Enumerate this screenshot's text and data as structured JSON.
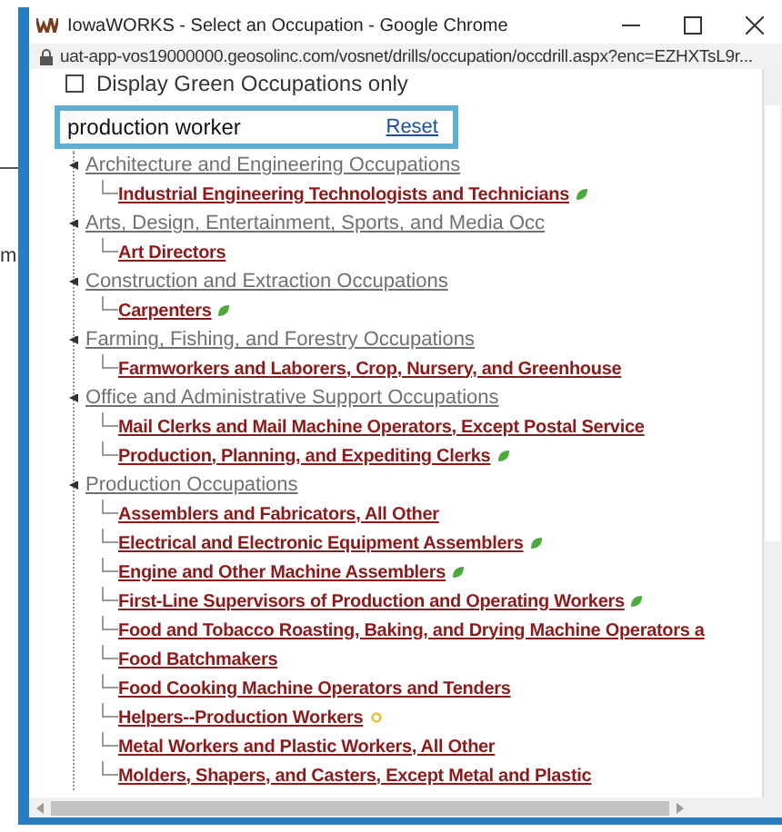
{
  "background_page": {
    "text": "m"
  },
  "window": {
    "title": "IowaWORKS - Select an Occupation - Google Chrome",
    "url": "uat-app-vos19000000.geosolinc.com/vosnet/drills/occupation/occdrill.aspx?enc=EZHXTsL9r..."
  },
  "green_only": {
    "label": "Display Green Occupations only",
    "checked": false
  },
  "search": {
    "value": "production worker",
    "reset": "Reset"
  },
  "tree": [
    {
      "label": "Architecture and Engineering Occupations",
      "children": [
        {
          "label": "Industrial Engineering Technologists and Technicians",
          "green": true,
          "bright_outlook": false
        }
      ]
    },
    {
      "label": "Arts, Design, Entertainment, Sports, and Media Occ",
      "children": [
        {
          "label": "Art Directors",
          "green": false,
          "bright_outlook": false
        }
      ]
    },
    {
      "label": "Construction and Extraction Occupations",
      "children": [
        {
          "label": "Carpenters",
          "green": true,
          "bright_outlook": false
        }
      ]
    },
    {
      "label": "Farming, Fishing, and Forestry Occupations",
      "children": [
        {
          "label": "Farmworkers and Laborers, Crop, Nursery, and Greenhouse",
          "green": false,
          "bright_outlook": false
        }
      ]
    },
    {
      "label": "Office and Administrative Support Occupations",
      "children": [
        {
          "label": "Mail Clerks and Mail Machine Operators, Except Postal Service",
          "green": false,
          "bright_outlook": false
        },
        {
          "label": "Production, Planning, and Expediting Clerks",
          "green": true,
          "bright_outlook": false
        }
      ]
    },
    {
      "label": "Production Occupations",
      "children": [
        {
          "label": "Assemblers and Fabricators, All Other",
          "green": false,
          "bright_outlook": false
        },
        {
          "label": "Electrical and Electronic Equipment Assemblers",
          "green": true,
          "bright_outlook": false
        },
        {
          "label": "Engine and Other Machine Assemblers",
          "green": true,
          "bright_outlook": false
        },
        {
          "label": "First-Line Supervisors of Production and Operating Workers",
          "green": true,
          "bright_outlook": false
        },
        {
          "label": "Food and Tobacco Roasting, Baking, and Drying Machine Operators a",
          "green": false,
          "bright_outlook": false
        },
        {
          "label": "Food Batchmakers",
          "green": false,
          "bright_outlook": false
        },
        {
          "label": "Food Cooking Machine Operators and Tenders",
          "green": false,
          "bright_outlook": false
        },
        {
          "label": "Helpers--Production Workers",
          "green": false,
          "bright_outlook": true
        },
        {
          "label": "Metal Workers and Plastic Workers, All Other",
          "green": false,
          "bright_outlook": false
        },
        {
          "label": "Molders, Shapers, and Casters, Except Metal and Plastic",
          "green": false,
          "bright_outlook": false
        }
      ]
    }
  ]
}
